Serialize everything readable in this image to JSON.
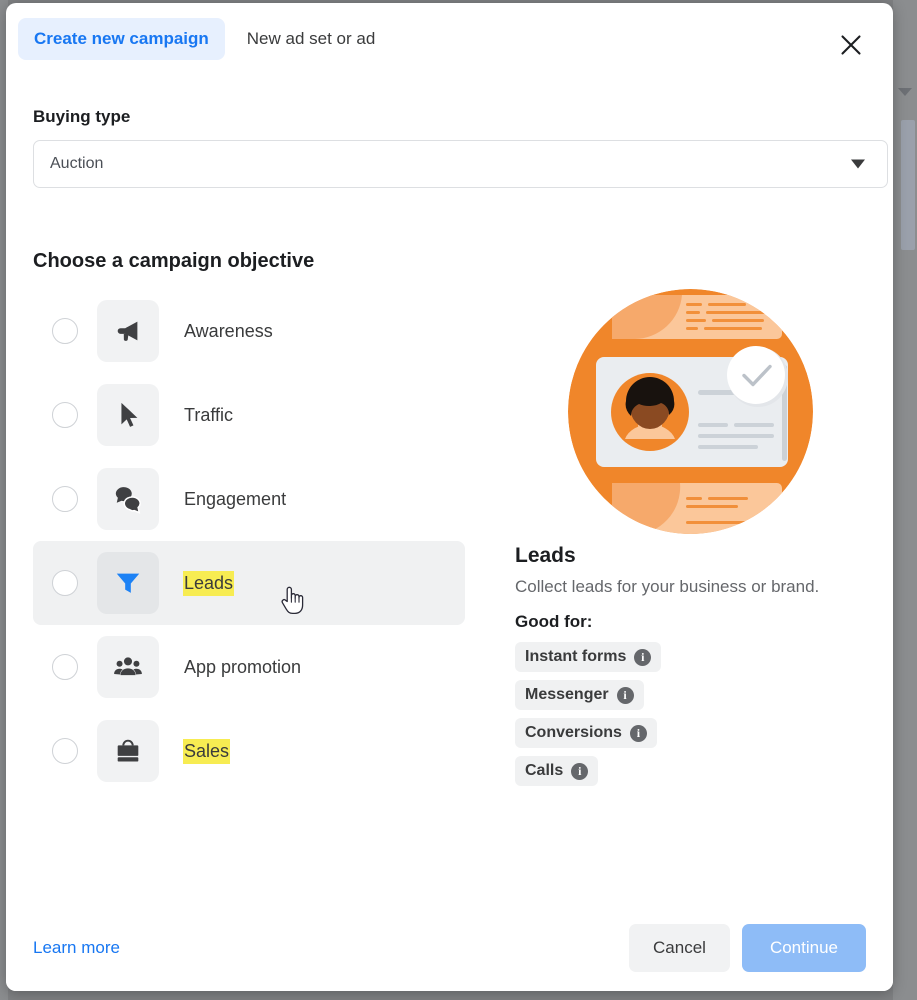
{
  "header": {
    "tab_create_campaign": "Create new campaign",
    "tab_new_adset_or_ad": "New ad set or ad",
    "close_icon": "close-icon"
  },
  "buying_type": {
    "label": "Buying type",
    "value": "Auction",
    "caret_icon": "chevron-down-icon"
  },
  "objectives": {
    "section_title": "Choose a campaign objective",
    "items": [
      {
        "label": "Awareness",
        "icon": "megaphone-icon",
        "selected": false,
        "hovered": false,
        "highlighted": false
      },
      {
        "label": "Traffic",
        "icon": "cursor-arrow-icon",
        "selected": false,
        "hovered": false,
        "highlighted": false
      },
      {
        "label": "Engagement",
        "icon": "chat-bubbles-icon",
        "selected": false,
        "hovered": false,
        "highlighted": false
      },
      {
        "label": "Leads",
        "icon": "funnel-icon",
        "selected": false,
        "hovered": true,
        "highlighted": true
      },
      {
        "label": "App promotion",
        "icon": "people-group-icon",
        "selected": false,
        "hovered": false,
        "highlighted": false
      },
      {
        "label": "Sales",
        "icon": "briefcase-icon",
        "selected": false,
        "hovered": false,
        "highlighted": true
      }
    ]
  },
  "detail": {
    "illustration": "leads-profile-card-illustration",
    "title": "Leads",
    "subtitle": "Collect leads for your business or brand.",
    "good_for_label": "Good for:",
    "chips": [
      {
        "label": "Instant forms",
        "info_icon": "info-icon"
      },
      {
        "label": "Messenger",
        "info_icon": "info-icon"
      },
      {
        "label": "Conversions",
        "info_icon": "info-icon"
      },
      {
        "label": "Calls",
        "info_icon": "info-icon"
      }
    ]
  },
  "footer": {
    "learn_more": "Learn more",
    "cancel": "Cancel",
    "continue": "Continue"
  },
  "colors": {
    "accent_blue": "#1877f2",
    "tab_active_bg": "#e7f0fe",
    "highlight_yellow": "#f7ec52",
    "continue_disabled_blue": "#8ebcf7",
    "illustration_orange": "#f0862a"
  },
  "cursor": {
    "icon": "pointing-hand-cursor"
  }
}
